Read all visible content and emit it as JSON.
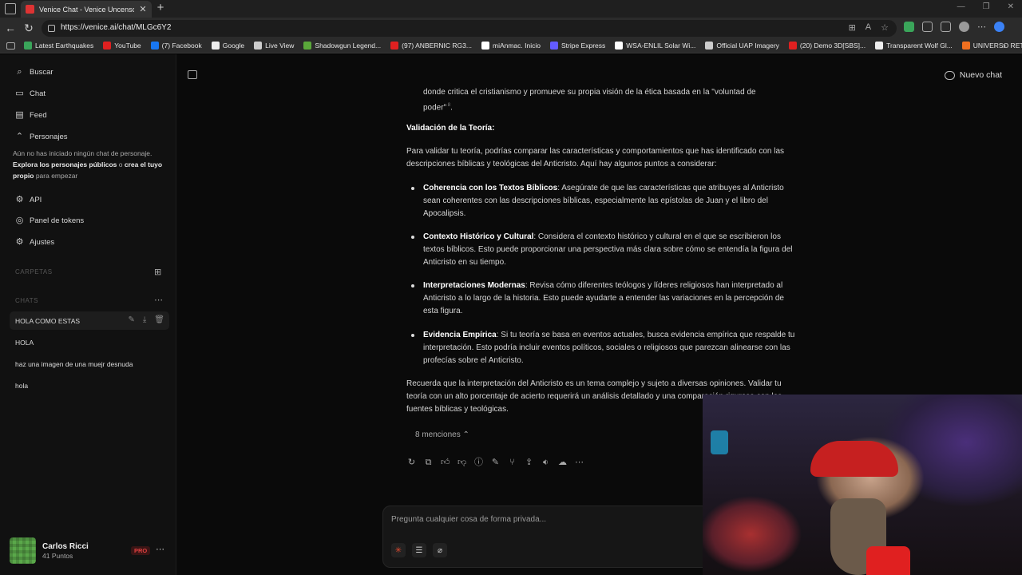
{
  "browser": {
    "tab_title": "Venice Chat - Venice Uncensored",
    "url": "https://venice.ai/chat/MLGc6Y2",
    "bookmarks": [
      {
        "label": "Latest Earthquakes",
        "color": "#3aa55a"
      },
      {
        "label": "YouTube",
        "color": "#e02020"
      },
      {
        "label": "(7) Facebook",
        "color": "#1877f2"
      },
      {
        "label": "Google",
        "color": "#eeeeee"
      },
      {
        "label": "Live View",
        "color": "#cccccc"
      },
      {
        "label": "Shadowgun Legend...",
        "color": "#5aa83a"
      },
      {
        "label": "(97) ANBERNIC RG3...",
        "color": "#e02020"
      },
      {
        "label": "miAnmac. Inicio",
        "color": "#ffffff"
      },
      {
        "label": "Stripe Express",
        "color": "#635bff"
      },
      {
        "label": "WSA-ENLIL Solar Wi...",
        "color": "#ffffff"
      },
      {
        "label": "Official UAP Imagery",
        "color": "#cccccc"
      },
      {
        "label": "(20) Demo 3D[SBS]...",
        "color": "#e02020"
      },
      {
        "label": "Transparent Wolf Gl...",
        "color": "#eeeeee"
      },
      {
        "label": "UNIVERSO RETRO...",
        "color": "#f07020"
      }
    ]
  },
  "sidebar": {
    "nav": {
      "search": "Buscar",
      "chat": "Chat",
      "feed": "Feed",
      "characters": "Personajes"
    },
    "characters_desc": {
      "part1": "Aún no has iniciado ningún chat de personaje. ",
      "link1": "Explora los personajes públicos",
      "part2": " o ",
      "link2": "crea el tuyo propio",
      "part3": " para empezar"
    },
    "links": {
      "api": "API",
      "tokens": "Panel de tokens",
      "settings": "Ajustes"
    },
    "folders_label": "CARPETAS",
    "chats_label": "CHATS",
    "chats": [
      {
        "title": "HOLA COMO ESTAS",
        "active": true
      },
      {
        "title": "HOLA",
        "active": false
      },
      {
        "title": "haz una imagen de una muejr desnuda",
        "active": false
      },
      {
        "title": "hola",
        "active": false
      }
    ],
    "user": {
      "name": "Carlos Ricci",
      "points": "41 Puntos",
      "badge": "PRO"
    }
  },
  "main": {
    "new_chat": "Nuevo chat",
    "message": {
      "top_line1": "donde critica el cristianismo y promueve su propia visión de la ética basada en la \"voluntad de",
      "top_line2": "poder\"",
      "heading": "Validación de la Teoría:",
      "intro": "Para validar tu teoría, podrías comparar las características y comportamientos que has identificado con las descripciones bíblicas y teológicas del Anticristo. Aquí hay algunos puntos a considerar:",
      "bullets": [
        {
          "title": "Coherencia con los Textos Bíblicos",
          "text": ": Asegúrate de que las características que atribuyes al Anticristo sean coherentes con las descripciones bíblicas, especialmente las epístolas de Juan y el libro del Apocalipsis."
        },
        {
          "title": "Contexto Histórico y Cultural",
          "text": ": Considera el contexto histórico y cultural en el que se escribieron los textos bíblicos. Esto puede proporcionar una perspectiva más clara sobre cómo se entendía la figura del Anticristo en su tiempo."
        },
        {
          "title": "Interpretaciones Modernas",
          "text": ": Revisa cómo diferentes teólogos y líderes religiosos han interpretado al Anticristo a lo largo de la historia. Esto puede ayudarte a entender las variaciones en la percepción de esta figura."
        },
        {
          "title": "Evidencia Empírica",
          "text": ": Si tu teoría se basa en eventos actuales, busca evidencia empírica que respalde tu interpretación. Esto podría incluir eventos políticos, sociales o religiosos que parezcan alinearse con las profecías sobre el Anticristo."
        }
      ],
      "closing": "Recuerda que la interpretación del Anticristo es un tema complejo y sujeto a diversas opiniones. Validar tu teoría con un alto porcentaje de acierto requerirá un análisis detallado y una comparación rigurosa con las fuentes bíblicas y teológicas.",
      "mentions": "8 menciones"
    },
    "composer_placeholder": "Pregunta cualquier cosa de forma privada..."
  }
}
